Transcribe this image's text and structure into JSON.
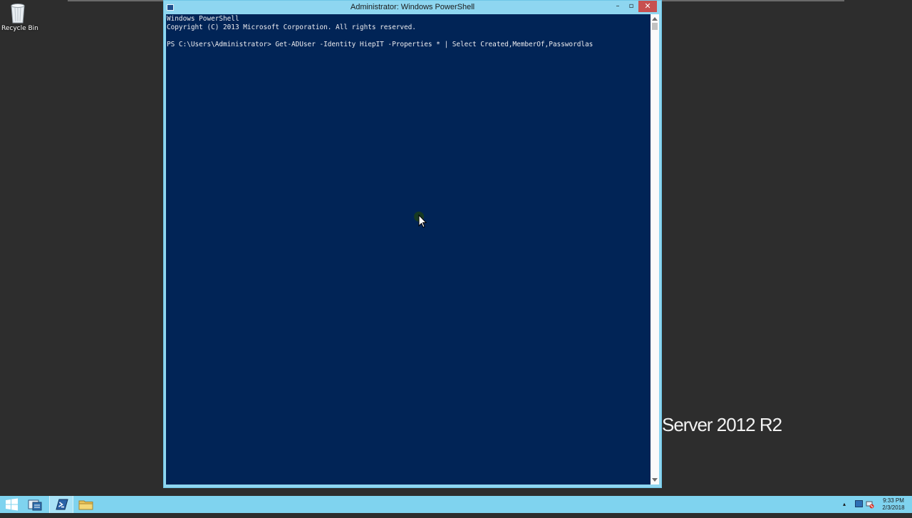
{
  "desktop": {
    "recycle_bin_label": "Recycle Bin",
    "watermark": "Server 2012 R2"
  },
  "window": {
    "title": "Administrator: Windows PowerShell",
    "minimize_glyph": "–",
    "maximize_glyph": "▫",
    "close_glyph": "✕"
  },
  "console": {
    "lines": [
      "Windows PowerShell",
      "Copyright (C) 2013 Microsoft Corporation. All rights reserved.",
      "",
      "PS C:\\Users\\Administrator> Get-ADUser -Identity HiepIT -Properties * | Select Created,MemberOf,Passwordlas"
    ],
    "colors": {
      "background": "#012456",
      "foreground": "#eeedf0"
    }
  },
  "taskbar": {
    "buttons": [
      "start-icon",
      "server-manager-icon",
      "powershell-icon",
      "file-explorer-icon"
    ],
    "clock_time": "9:33 PM",
    "clock_date": "2/3/2018",
    "tray_overflow_glyph": "▴"
  },
  "colors": {
    "taskbar": "#7fd3ef",
    "window_frame": "#8ed6f0",
    "close_button": "#c75050",
    "desktop": "#2d2d2d"
  }
}
